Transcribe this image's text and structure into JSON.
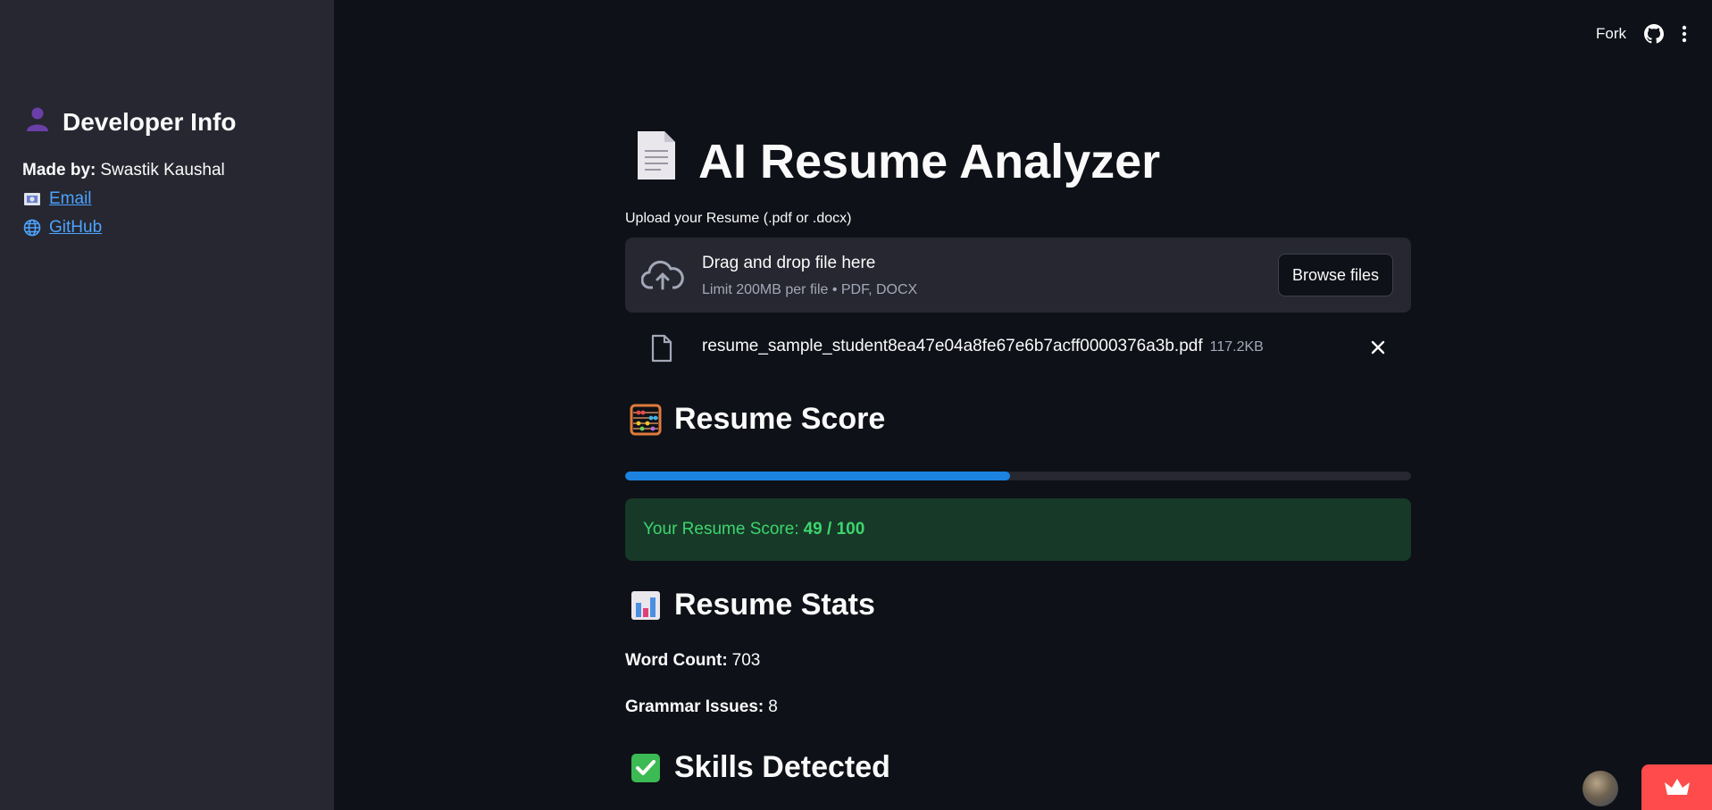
{
  "sidebar": {
    "title": "Developer Info",
    "title_icon": "person-icon",
    "made_by_label": "Made by:",
    "made_by_value": "Swastik Kaushal",
    "email_link": "Email",
    "github_link": "GitHub"
  },
  "topbar": {
    "fork_label": "Fork",
    "icons": [
      "github-icon",
      "more-vert-icon"
    ]
  },
  "main": {
    "title": "AI Resume Analyzer",
    "upload": {
      "label": "Upload your Resume (.pdf or .docx)",
      "drop_text": "Drag and drop file here",
      "limit_text": "Limit 200MB per file • PDF, DOCX",
      "browse_label": "Browse files"
    },
    "file": {
      "name": "resume_sample_student8ea47e04a8fe67e6b7acff0000376a3b.pdf",
      "size": "117.2KB"
    },
    "score_section": {
      "heading": "Resume Score",
      "progress": 0.49,
      "score_label": "Your Resume Score:",
      "score_value": "49 / 100"
    },
    "stats_section": {
      "heading": "Resume Stats",
      "word_count_label": "Word Count:",
      "word_count_value": "703",
      "grammar_label": "Grammar Issues:",
      "grammar_value": "8"
    },
    "skills_section": {
      "heading": "Skills Detected"
    }
  },
  "colors": {
    "background": "#0e1117",
    "sidebar": "#262730",
    "accent_blue": "#1c83e1",
    "success_bg": "#173928",
    "success_text": "#3dd56d",
    "link": "#4da3ff",
    "streamlit_red": "#ff4b4b"
  }
}
